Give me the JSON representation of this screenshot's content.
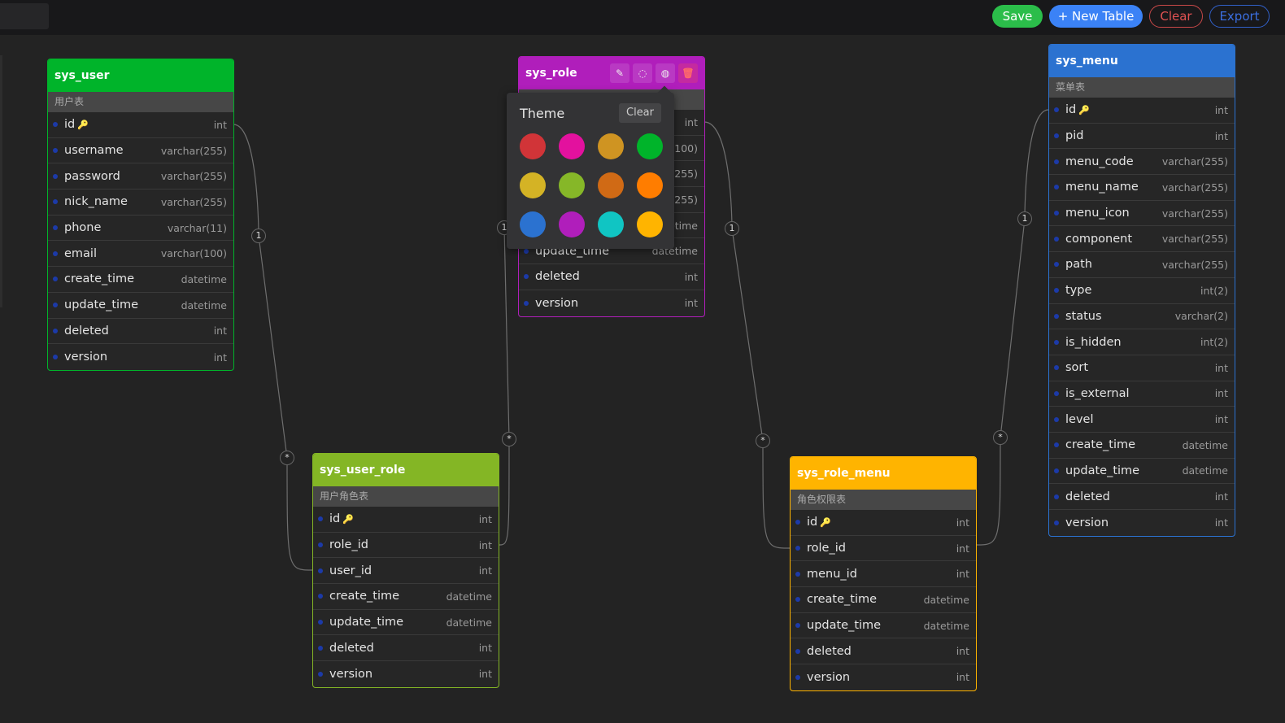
{
  "toolbar": {
    "save": "Save",
    "new_table": "+ New Table",
    "clear": "Clear",
    "export": "Export"
  },
  "colors": {
    "save": "#2bbd4a",
    "new_table": "#3b82f6",
    "clear": "#e05252",
    "export": "#3b6fe0"
  },
  "tables": [
    {
      "id": "sys_user",
      "name": "sys_user",
      "comment": "用户表",
      "color": "#00b42a",
      "fields": [
        [
          "id",
          "int",
          true
        ],
        [
          "username",
          "varchar(255)"
        ],
        [
          "password",
          "varchar(255)"
        ],
        [
          "nick_name",
          "varchar(255)"
        ],
        [
          "phone",
          "varchar(11)"
        ],
        [
          "email",
          "varchar(100)"
        ],
        [
          "create_time",
          "datetime"
        ],
        [
          "update_time",
          "datetime"
        ],
        [
          "deleted",
          "int"
        ],
        [
          "version",
          "int"
        ]
      ]
    },
    {
      "id": "sys_role",
      "name": "sys_role",
      "comment": "",
      "color": "#b01ebb",
      "actions": [
        "edit-icon",
        "comment-icon",
        "palette-icon",
        "delete-icon"
      ],
      "fields": [
        [
          "",
          "int"
        ],
        [
          "",
          "(100)"
        ],
        [
          "",
          "(255)"
        ],
        [
          "",
          "(255)"
        ],
        [
          "",
          "etime"
        ],
        [
          "update_time",
          "datetime"
        ],
        [
          "deleted",
          "int"
        ],
        [
          "version",
          "int"
        ]
      ]
    },
    {
      "id": "sys_user_role",
      "name": "sys_user_role",
      "comment": "用户角色表",
      "color": "#84b625",
      "fields": [
        [
          "id",
          "int",
          true
        ],
        [
          "role_id",
          "int"
        ],
        [
          "user_id",
          "int"
        ],
        [
          "create_time",
          "datetime"
        ],
        [
          "update_time",
          "datetime"
        ],
        [
          "deleted",
          "int"
        ],
        [
          "version",
          "int"
        ]
      ]
    },
    {
      "id": "sys_role_menu",
      "name": "sys_role_menu",
      "comment": "角色权限表",
      "color": "#ffb400",
      "fields": [
        [
          "id",
          "int",
          true
        ],
        [
          "role_id",
          "int"
        ],
        [
          "menu_id",
          "int"
        ],
        [
          "create_time",
          "datetime"
        ],
        [
          "update_time",
          "datetime"
        ],
        [
          "deleted",
          "int"
        ],
        [
          "version",
          "int"
        ]
      ]
    },
    {
      "id": "sys_menu",
      "name": "sys_menu",
      "comment": "菜单表",
      "color": "#2b72d0",
      "fields": [
        [
          "id",
          "int",
          true
        ],
        [
          "pid",
          "int"
        ],
        [
          "menu_code",
          "varchar(255)"
        ],
        [
          "menu_name",
          "varchar(255)"
        ],
        [
          "menu_icon",
          "varchar(255)"
        ],
        [
          "component",
          "varchar(255)"
        ],
        [
          "path",
          "varchar(255)"
        ],
        [
          "type",
          "int(2)"
        ],
        [
          "status",
          "varchar(2)"
        ],
        [
          "is_hidden",
          "int(2)"
        ],
        [
          "sort",
          "int"
        ],
        [
          "is_external",
          "int"
        ],
        [
          "level",
          "int"
        ],
        [
          "create_time",
          "datetime"
        ],
        [
          "update_time",
          "datetime"
        ],
        [
          "deleted",
          "int"
        ],
        [
          "version",
          "int"
        ]
      ]
    }
  ],
  "relations": [
    {
      "from": "sys_user.id",
      "to": "sys_user_role.user_id",
      "one": "1",
      "many": "*"
    },
    {
      "from": "sys_role.id",
      "to": "sys_user_role.role_id",
      "one": "1",
      "many": "*"
    },
    {
      "from": "sys_role.id",
      "to": "sys_role_menu.role_id",
      "one": "1",
      "many": "*"
    },
    {
      "from": "sys_menu.id",
      "to": "sys_role_menu.menu_id",
      "one": "1",
      "many": "*"
    }
  ],
  "theme_popup": {
    "title": "Theme",
    "clear": "Clear",
    "swatches": [
      "#d13438",
      "#e3119e",
      "#cf9422",
      "#00b42a",
      "#d4b325",
      "#86b728",
      "#d06a15",
      "#ff7d00",
      "#2b72d0",
      "#b01ebb",
      "#10c5c3",
      "#ffb400"
    ]
  }
}
